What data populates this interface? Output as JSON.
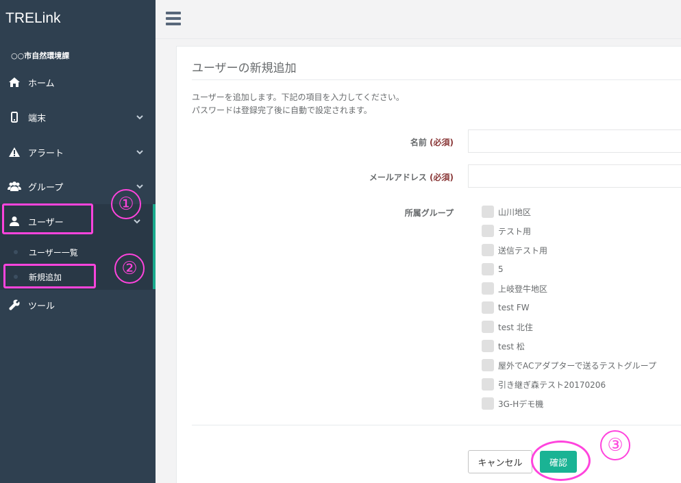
{
  "sidebar": {
    "brand": "TRELink",
    "org": "○○市自然環境課",
    "items": [
      {
        "label": "ホーム"
      },
      {
        "label": "端末"
      },
      {
        "label": "アラート"
      },
      {
        "label": "グループ"
      },
      {
        "label": "ユーザー"
      },
      {
        "label": "ツール"
      }
    ],
    "user_sub": [
      {
        "label": "ユーザー一覧"
      },
      {
        "label": "新規追加"
      }
    ]
  },
  "panel": {
    "title": "ユーザーの新規追加",
    "desc1": "ユーザーを追加します。下記の項目を入力してください。",
    "desc2": "パスワードは登録完了後に自動で設定されます。",
    "name_label": "名前",
    "email_label": "メールアドレス",
    "required": "(必須)",
    "group_label": "所属グループ",
    "groups": [
      "山川地区",
      "テスト用",
      "送信テスト用",
      "5",
      "上岐登牛地区",
      "test FW",
      "test 北住",
      "test 松",
      "屋外でACアダプターで送るテストグループ",
      "引き継ぎ森テスト20170206",
      "3G-Hデモ機"
    ],
    "cancel_label": "キャンセル",
    "confirm_label": "確認"
  },
  "annotations": [
    "①",
    "②",
    "③"
  ],
  "colors": {
    "sidebar_bg": "#2f4050",
    "accent": "#1ab394",
    "annotation": "#ff44dd"
  }
}
